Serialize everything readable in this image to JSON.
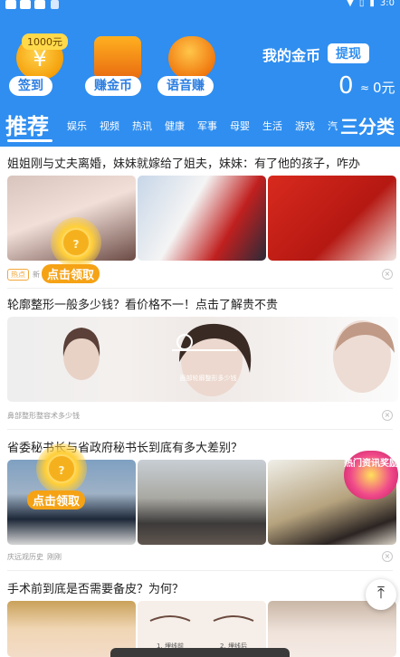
{
  "status_bar": {
    "time": "3:0"
  },
  "header": {
    "features": [
      {
        "label": "签到",
        "badge": "1000元"
      },
      {
        "label": "赚金币"
      },
      {
        "label": "语音赚"
      }
    ],
    "coins": {
      "title": "我的金币",
      "withdraw": "提现",
      "count": "0",
      "approx": "≈",
      "yuan": "0元"
    }
  },
  "tabs": {
    "active": "推荐",
    "items": [
      "娱乐",
      "视频",
      "热讯",
      "健康",
      "军事",
      "母婴",
      "生活",
      "游戏",
      "汽"
    ],
    "category": "三分类"
  },
  "feed": [
    {
      "title": "姐姐刚与丈夫离婚，妹妹就嫁给了姐夫，妹妹：有了他的孩子，咋办",
      "tag": "热点",
      "source": "新",
      "reward": "点击领取"
    },
    {
      "title": "轮廓整形一般多少钱？看价格不一！点击了解贵不贵",
      "source": "鼻部整形整容术多少钱",
      "overlay": "面部轮廓整形多少钱"
    },
    {
      "title": "省委秘书长与省政府秘书长到底有多大差别？",
      "source": "庆远观历史",
      "time": "刚刚",
      "reward": "点击领取",
      "stamp": "热门资讯奖励"
    },
    {
      "title": "手术前到底是否需要备皮？为何？",
      "captions": [
        "1. 埋线前",
        "2. 埋线后"
      ]
    }
  ],
  "colors": {
    "brand_blue": "#2f8ef0",
    "reward_orange": "#f5a215",
    "hot_tag": "#f2a73a"
  }
}
